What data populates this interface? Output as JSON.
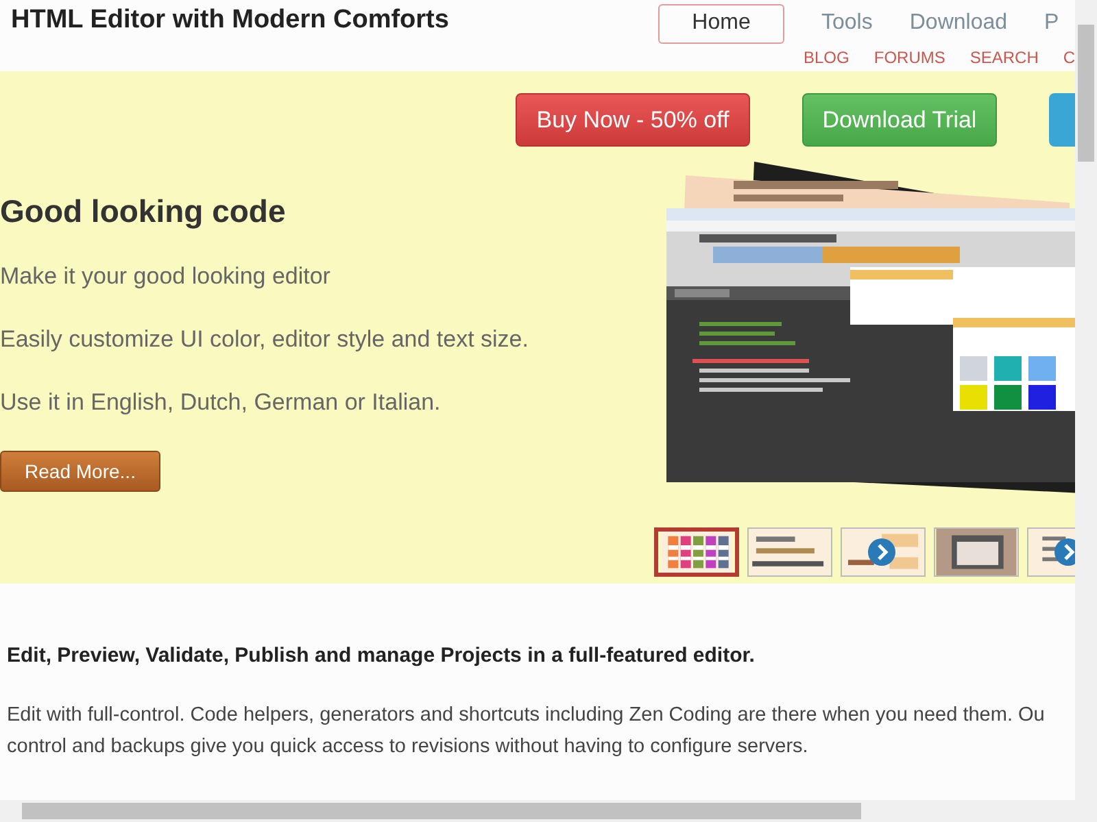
{
  "header": {
    "title": "HTML Editor with Modern Comforts",
    "nav": [
      {
        "label": "Home",
        "selected": true
      },
      {
        "label": "Tools",
        "selected": false
      },
      {
        "label": "Download",
        "selected": false
      },
      {
        "label": "P",
        "selected": false
      }
    ],
    "subnav": [
      "BLOG",
      "FORUMS",
      "SEARCH",
      "C"
    ]
  },
  "hero": {
    "buttons": [
      {
        "label": "Buy Now - 50% off",
        "kind": "buy"
      },
      {
        "label": "Download Trial",
        "kind": "trial"
      },
      {
        "kind": "info"
      }
    ],
    "heading": "Good looking code",
    "lines": [
      "Make it your good looking editor",
      "Easily customize UI color, editor style and text size.",
      "Use it in English, Dutch, German or Italian."
    ],
    "read_more": "Read More...",
    "thumbnails": [
      {
        "kind": "palette",
        "selected": true,
        "arrow": false
      },
      {
        "kind": "code",
        "selected": false,
        "arrow": false
      },
      {
        "kind": "links",
        "selected": false,
        "arrow": true
      },
      {
        "kind": "window",
        "selected": false,
        "arrow": false
      },
      {
        "kind": "list",
        "selected": false,
        "arrow": true
      }
    ]
  },
  "section": {
    "heading": "Edit, Preview, Validate, Publish and manage Projects in a full-featured editor.",
    "paragraph_lines": [
      "Edit with full-control. Code helpers, generators and shortcuts including Zen Coding are there when you need them. Ou",
      "control and backups give you quick access to revisions without having to configure servers."
    ]
  }
}
